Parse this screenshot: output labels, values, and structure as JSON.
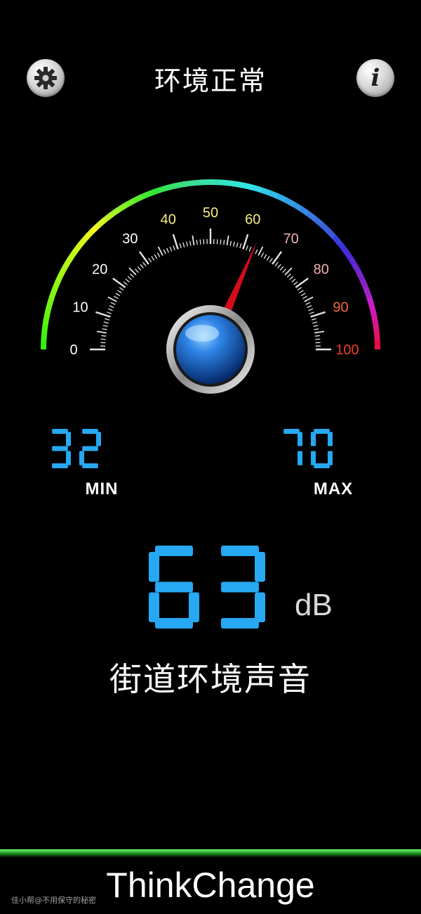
{
  "header": {
    "title": "环境正常",
    "settings_icon": "gear-icon",
    "info_icon": "info-icon",
    "info_glyph": "i"
  },
  "gauge": {
    "min": 0,
    "max": 100,
    "needle_value": 63,
    "tick_labels": [
      "0",
      "10",
      "20",
      "30",
      "40",
      "50",
      "60",
      "70",
      "80",
      "90",
      "100"
    ],
    "label_colors": [
      "#ffffff",
      "#ffffff",
      "#ffffff",
      "#ffffff",
      "#f7ef82",
      "#f7ef82",
      "#f7ef82",
      "#f4b0b0",
      "#f4b0b0",
      "#f06a3e",
      "#f03b20"
    ],
    "needle_color": "#d30c1b",
    "hub_color": "#1f6fd6"
  },
  "readings": {
    "min_value": "32",
    "min_label": "MIN",
    "max_value": "70",
    "max_label": "MAX",
    "current_value": "63",
    "unit": "dB",
    "environment": "街道环境声音",
    "digit_color": "#27a8f2"
  },
  "footer": {
    "brand": "ThinkChange",
    "watermark": "佳小帮@不用保守的秘密"
  }
}
